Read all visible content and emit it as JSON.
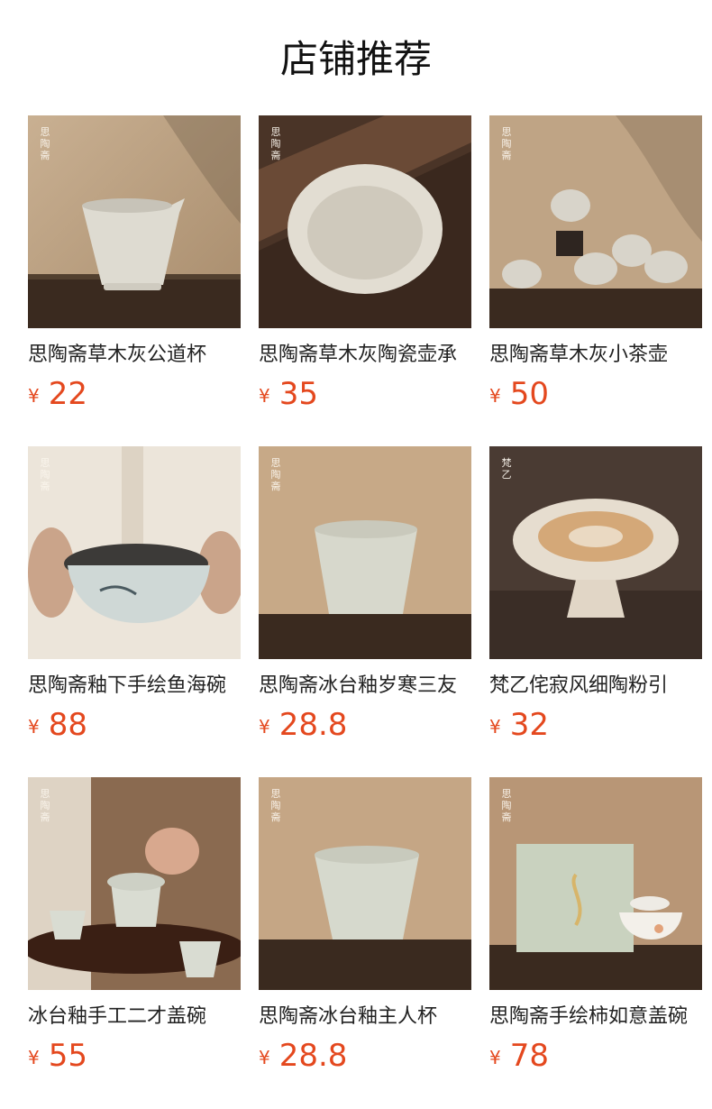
{
  "header": {
    "title": "店铺推荐"
  },
  "colors": {
    "price": "#e4481e",
    "text": "#222222"
  },
  "products": [
    {
      "name": "思陶斋草木灰公道杯",
      "currency": "¥",
      "price": "22",
      "seal": "思陶斋",
      "image": "fair-cup"
    },
    {
      "name": "思陶斋草木灰陶瓷壶承",
      "currency": "¥",
      "price": "35",
      "seal": "思陶斋",
      "image": "plate"
    },
    {
      "name": "思陶斋草木灰小茶壶",
      "currency": "¥",
      "price": "50",
      "seal": "思陶斋",
      "image": "teapots"
    },
    {
      "name": "思陶斋釉下手绘鱼海碗",
      "currency": "¥",
      "price": "88",
      "seal": "思陶斋",
      "image": "fish-bowl"
    },
    {
      "name": "思陶斋冰台釉岁寒三友",
      "currency": "¥",
      "price": "28.8",
      "seal": "思陶斋",
      "image": "cup"
    },
    {
      "name": "梵乙侘寂风细陶粉引",
      "currency": "¥",
      "price": "32",
      "seal": "梵乙",
      "image": "stem-bowl"
    },
    {
      "name": "冰台釉手工二才盖碗",
      "currency": "¥",
      "price": "55",
      "seal": "思陶斋",
      "image": "gaiwan-set"
    },
    {
      "name": "思陶斋冰台釉主人杯",
      "currency": "¥",
      "price": "28.8",
      "seal": "思陶斋",
      "image": "master-cup"
    },
    {
      "name": "思陶斋手绘柿如意盖碗",
      "currency": "¥",
      "price": "78",
      "seal": "思陶斋",
      "image": "gift-box"
    }
  ]
}
